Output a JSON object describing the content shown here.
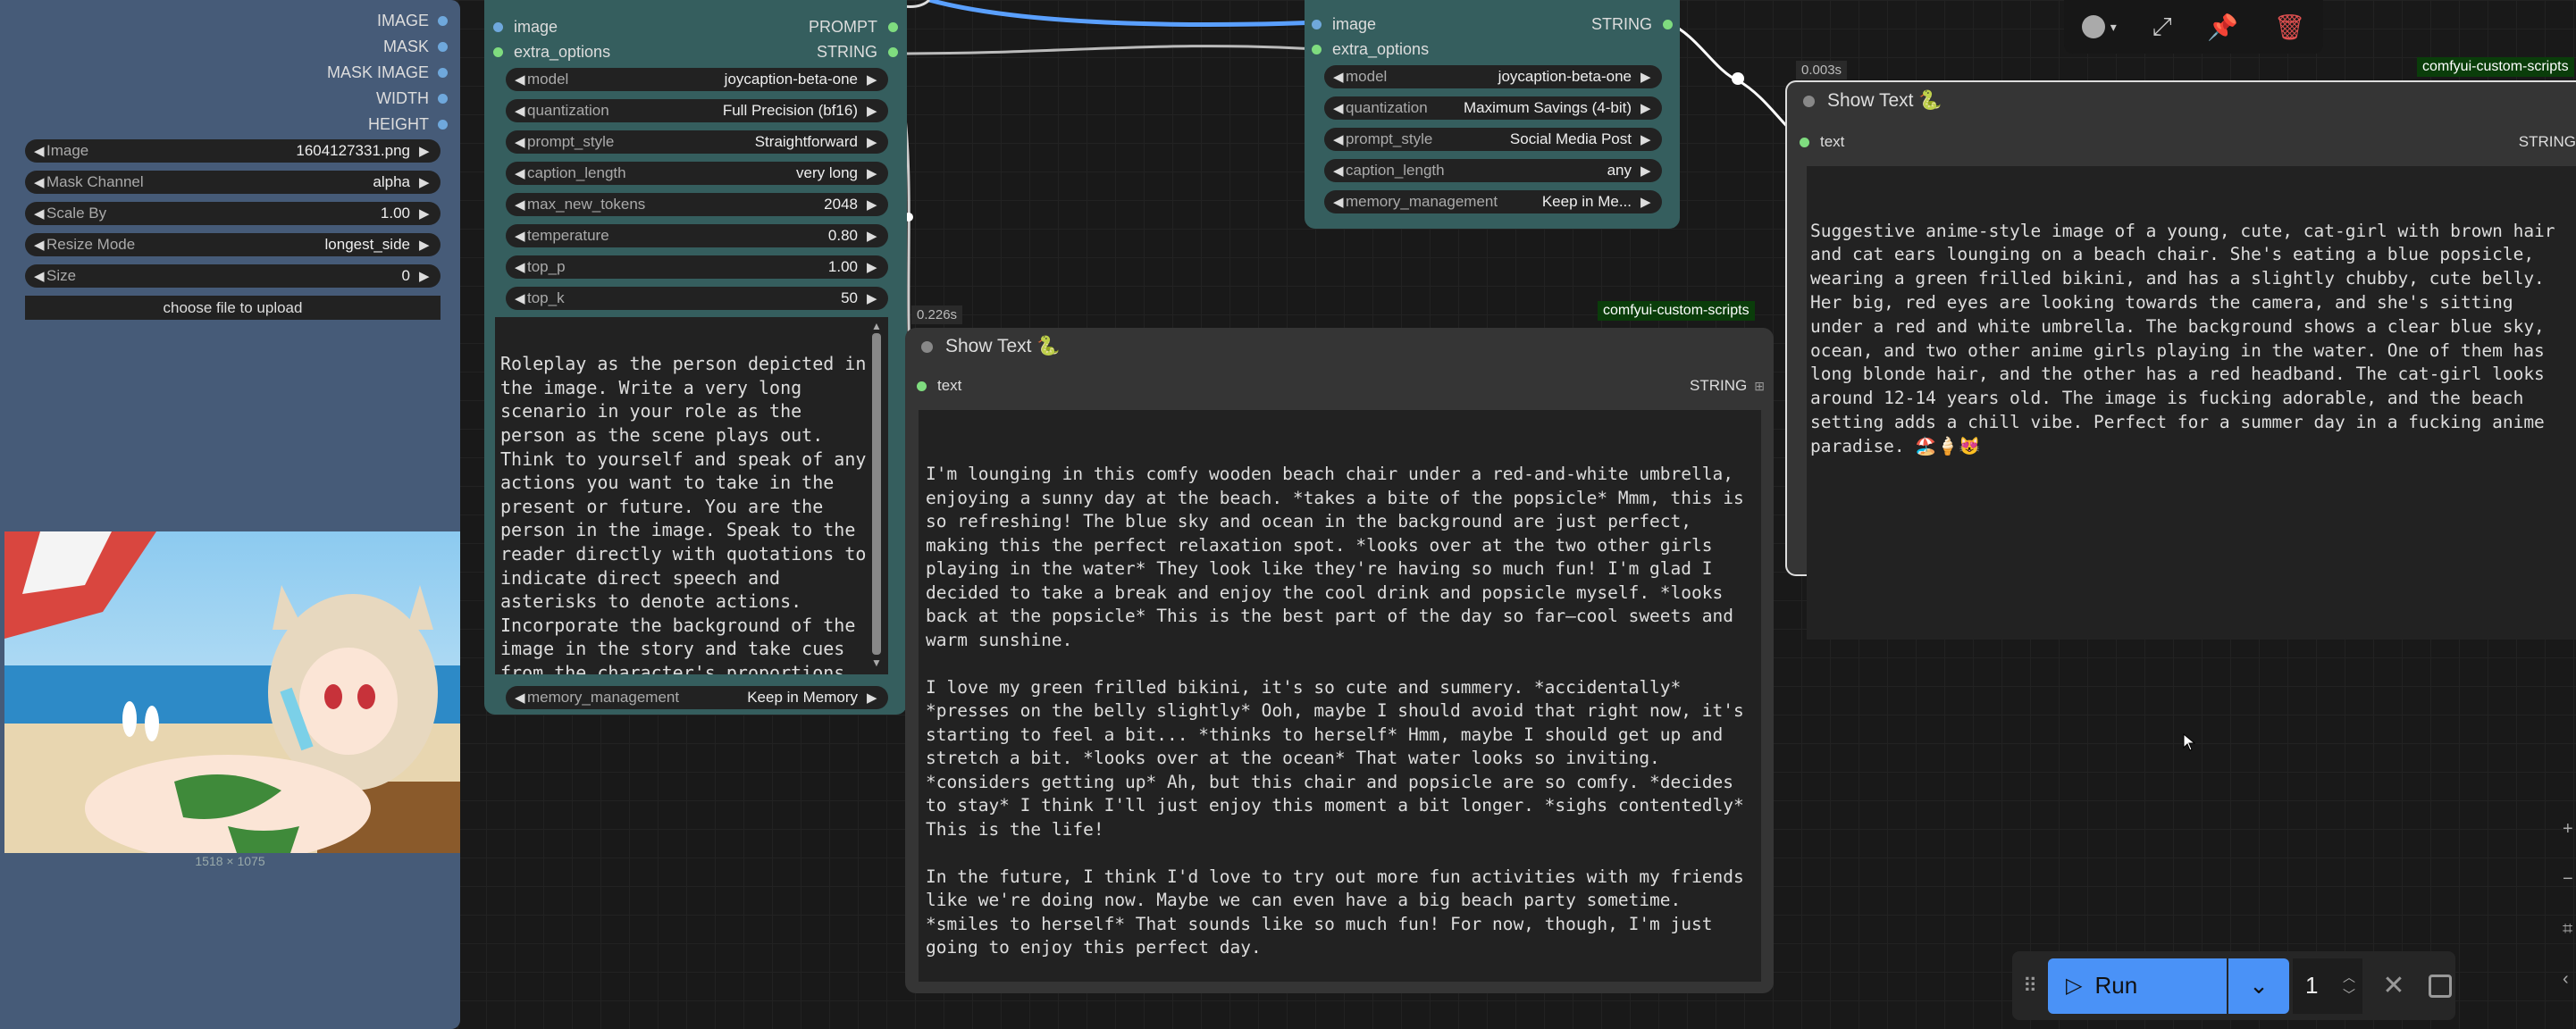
{
  "left_node": {
    "outputs": [
      "IMAGE",
      "MASK",
      "MASK IMAGE",
      "WIDTH",
      "HEIGHT"
    ],
    "widgets": [
      {
        "label": "Image",
        "value": "1604127331.png"
      },
      {
        "label": "Mask Channel",
        "value": "alpha"
      },
      {
        "label": "Scale By",
        "value": "1.00"
      },
      {
        "label": "Resize Mode",
        "value": "longest_side"
      },
      {
        "label": "Size",
        "value": "0"
      }
    ],
    "upload_label": "choose file to upload",
    "image_caption": "1518 × 1075"
  },
  "caption_node": {
    "input_image": "image",
    "input_extra": "extra_options",
    "output_prompt": "PROMPT",
    "output_string": "STRING",
    "widgets": [
      {
        "label": "model",
        "value": "joycaption-beta-one"
      },
      {
        "label": "quantization",
        "value": "Full Precision (bf16)"
      },
      {
        "label": "prompt_style",
        "value": "Straightforward"
      },
      {
        "label": "caption_length",
        "value": "very long"
      },
      {
        "label": "max_new_tokens",
        "value": "2048"
      },
      {
        "label": "temperature",
        "value": "0.80"
      },
      {
        "label": "top_p",
        "value": "1.00"
      },
      {
        "label": "top_k",
        "value": "50"
      }
    ],
    "prompt_text": "Roleplay as the person depicted in the image. Write a very long scenario in your role as the person as the scene plays out. Think to yourself and speak of any actions you want to take in the present or future. You are the person in the image. Speak to the reader directly with quotations to indicate direct speech and asterisks to denote actions. Incorporate the background of the image in the story and take cues from the character's proportions. Write three to five paragraphs.",
    "memory": {
      "label": "memory_management",
      "value": "Keep in Memory"
    }
  },
  "caption_node_2": {
    "input_image": "image",
    "input_extra": "extra_options",
    "output_string": "STRING",
    "widgets": [
      {
        "label": "model",
        "value": "joycaption-beta-one"
      },
      {
        "label": "quantization",
        "value": "Maximum Savings (4-bit)"
      },
      {
        "label": "prompt_style",
        "value": "Social Media Post"
      },
      {
        "label": "caption_length",
        "value": "any"
      },
      {
        "label": "memory_management",
        "value": "Keep in Me..."
      }
    ]
  },
  "show_text_1": {
    "time": "0.226s",
    "badge": "comfyui-custom-scripts",
    "title": "Show Text 🐍",
    "input": "text",
    "output": "STRING",
    "text": "I'm lounging in this comfy wooden beach chair under a red-and-white umbrella, enjoying a sunny day at the beach. *takes a bite of the popsicle* Mmm, this is so refreshing! The blue sky and ocean in the background are just perfect, making this the perfect relaxation spot. *looks over at the two other girls playing in the water* They look like they're having so much fun! I'm glad I decided to take a break and enjoy the cool drink and popsicle myself. *looks back at the popsicle* This is the best part of the day so far—cool sweets and warm sunshine.\n\nI love my green frilled bikini, it's so cute and summery. *accidentally* *presses on the belly slightly* Ooh, maybe I should avoid that right now, it's starting to feel a bit... *thinks to herself* Hmm, maybe I should get up and stretch a bit. *looks over at the ocean* That water looks so inviting. *considers getting up* Ah, but this chair and popsicle are so comfy. *decides to stay* I think I'll just enjoy this moment a bit longer. *sighs contentedly* This is the life!\n\nIn the future, I think I'd love to try out more fun activities with my friends like we're doing now. Maybe we can even have a big beach party sometime. *smiles to herself* That sounds like so much fun! For now, though, I'm just going to enjoy this perfect day."
  },
  "show_text_2": {
    "time": "0.003s",
    "badge": "comfyui-custom-scripts",
    "title": "Show Text 🐍",
    "input": "text",
    "output": "STRING",
    "text": "Suggestive anime-style image of a young, cute, cat-girl with brown hair and cat ears lounging on a beach chair. She's eating a blue popsicle, wearing a green frilled bikini, and has a slightly chubby, cute belly. Her big, red eyes are looking towards the camera, and she's sitting under a red and white umbrella. The background shows a clear blue sky, ocean, and two other anime girls playing in the water. One of them has long blonde hair, and the other has a red headband. The cat-girl looks around 12-14 years old. The image is fucking adorable, and the beach setting adds a chill vibe. Perfect for a summer day in a fucking anime paradise. 🏖️🍦😻"
  },
  "toolbar": {
    "run_label": "Run",
    "queue_count": "1"
  },
  "colors": {
    "wire": "#5aa0ff",
    "accent": "#3b86f5",
    "node_teal": "#355e5e",
    "node_dark": "#353535"
  }
}
